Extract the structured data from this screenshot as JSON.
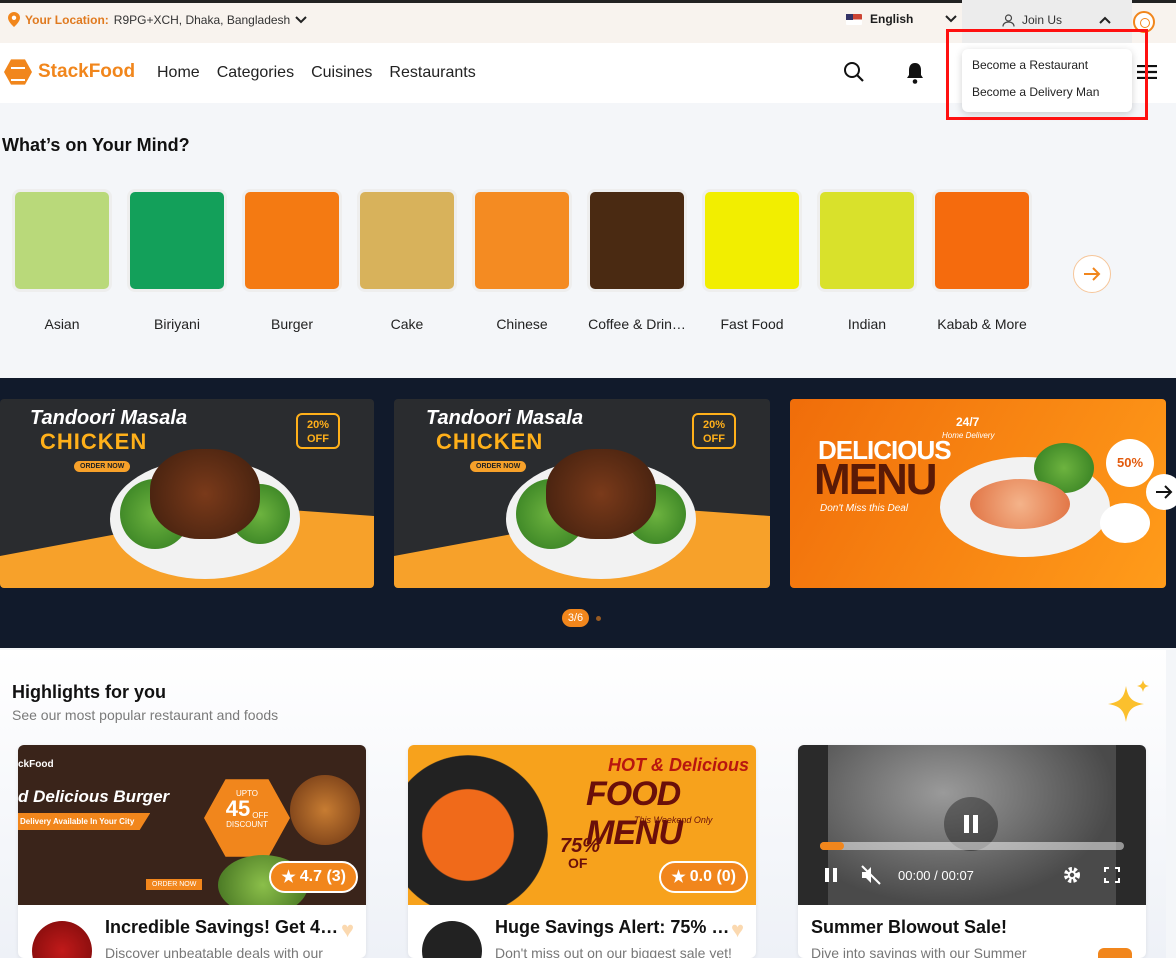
{
  "topbar": {
    "location_label": "Your Location:",
    "location_value": "R9PG+XCH, Dhaka, Bangladesh",
    "language": "English",
    "join_label": "Join Us"
  },
  "nav": {
    "brand": "StackFood",
    "items": [
      "Home",
      "Categories",
      "Cuisines",
      "Restaurants"
    ]
  },
  "join_menu": {
    "items": [
      "Become a Restaurant",
      "Become a Delivery Man"
    ]
  },
  "mind": {
    "title": "What’s on Your Mind?",
    "categories": [
      "Asian",
      "Biriyani",
      "Burger",
      "Cake",
      "Chinese",
      "Coffee & Drin…",
      "Fast Food",
      "Indian",
      "Kabab & More"
    ],
    "colors": [
      "#b9d97a",
      "#13a05a",
      "#f47a12",
      "#d8b25b",
      "#f48b22",
      "#4a2a12",
      "#f2ee00",
      "#d9e12b",
      "#f56b0d"
    ]
  },
  "banners": {
    "b1": {
      "script": "Tandoori Masala",
      "big": "CHICKEN",
      "badge": "20% OFF",
      "cta": "ORDER NOW"
    },
    "b2": {
      "script": "Tandoori Masala",
      "big": "CHICKEN",
      "badge": "20% OFF",
      "cta": "ORDER NOW"
    },
    "b3": {
      "big1": "DELICIOUS",
      "big2": "MENU",
      "tag": "24/7",
      "tag2": "Home Delivery",
      "script": "Don't Miss this Deal",
      "badge": "50%"
    },
    "pager": "3/6"
  },
  "highlights": {
    "title": "Highlights for you",
    "subtitle": "See our most popular restaurant and foods",
    "cards": [
      {
        "brand": "ckFood",
        "headline": "d Delicious Burger",
        "ribbon": "Delivery Available In Your City",
        "offer_pre": "UPTO",
        "offer_num": "45",
        "offer_off": "OFF",
        "offer_label": "DISCOUNT",
        "rating": "4.7 (3)",
        "title": "Incredible Savings! Get 4…",
        "desc": "Discover unbeatable deals with our",
        "cta": "ORDER NOW"
      },
      {
        "headline1": "HOT & Delicious",
        "headline2": "FOOD MENU",
        "script": "This Weekend Only",
        "offer": "75%",
        "offer_of": "OF",
        "rating": "0.0 (0)",
        "title": "Huge Savings Alert: 75% …",
        "desc": "Don't miss out on our biggest sale yet!"
      },
      {
        "time": "00:00 / 00:07",
        "title": "Summer Blowout Sale!",
        "desc": "Dive into savings with our Summer"
      }
    ]
  }
}
